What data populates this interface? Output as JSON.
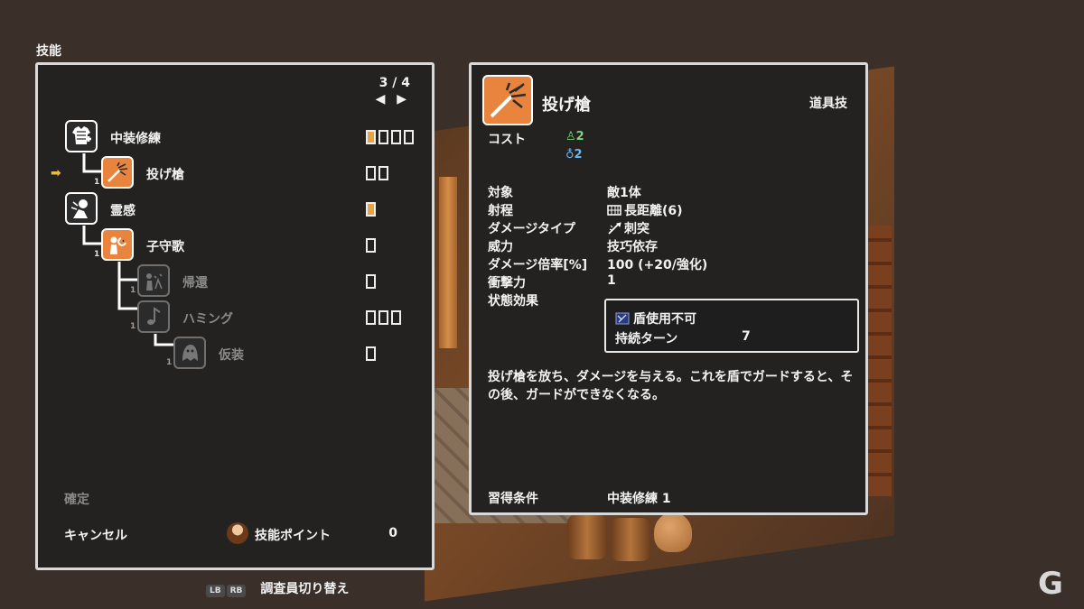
{
  "screen_title": "技能",
  "pager": {
    "text": "3 / 4",
    "arrows": "◀ ▶"
  },
  "skills": [
    {
      "name": "中装修練",
      "level": "",
      "pips": [
        true,
        false,
        false,
        false
      ],
      "dim": false,
      "icon": "armor-training-icon"
    },
    {
      "name": "投げ槍",
      "level": "1",
      "pips": [
        false,
        false
      ],
      "dim": false,
      "icon": "throw-spear-icon"
    },
    {
      "name": "霊感",
      "level": "",
      "pips": [
        true
      ],
      "dim": false,
      "icon": "inspiration-icon"
    },
    {
      "name": "子守歌",
      "level": "1",
      "pips": [
        false
      ],
      "dim": false,
      "icon": "lullaby-icon"
    },
    {
      "name": "帰還",
      "level": "1",
      "pips": [
        false
      ],
      "dim": true,
      "icon": "return-icon"
    },
    {
      "name": "ハミング",
      "level": "1",
      "pips": [
        false,
        false,
        false
      ],
      "dim": true,
      "icon": "humming-icon"
    },
    {
      "name": "仮装",
      "level": "1",
      "pips": [
        false
      ],
      "dim": true,
      "icon": "disguise-icon"
    }
  ],
  "actions": {
    "confirm": "確定",
    "cancel": "キャンセル"
  },
  "skill_points": {
    "label": "技能ポイント",
    "value": "0"
  },
  "bottom_hint": {
    "lb": "LB",
    "rb": "RB",
    "text": "調査員切り替え"
  },
  "detail": {
    "title": "投げ槍",
    "type": "道具技",
    "cost_label": "コスト",
    "cost_a": "2",
    "cost_b": "2",
    "stats": [
      {
        "key": "対象",
        "value": "敵1体",
        "icon": ""
      },
      {
        "key": "射程",
        "value": "長距離(6)",
        "icon": "range-icon"
      },
      {
        "key": "ダメージタイプ",
        "value": "刺突",
        "icon": "pierce-icon"
      },
      {
        "key": "威力",
        "value": "技巧依存",
        "icon": ""
      },
      {
        "key": "ダメージ倍率[%]",
        "value": "100 (+20/強化)",
        "icon": ""
      },
      {
        "key": "衝撃力",
        "value": "1",
        "icon": ""
      },
      {
        "key": "状態効果",
        "value": "",
        "icon": ""
      }
    ],
    "status_effect": {
      "name": "盾使用不可",
      "duration_label": "持続ターン",
      "duration_value": "7"
    },
    "description": "投げ槍を放ち、ダメージを与える。これを盾でガードすると、その後、ガードができなくなる。",
    "requirement_label": "習得条件",
    "requirement_value": "中装修練 1"
  },
  "colors": {
    "accent": "#e8843e",
    "pip": "#e8a43e",
    "cost_green": "#7ad67a",
    "cost_blue": "#6ab8ee"
  }
}
